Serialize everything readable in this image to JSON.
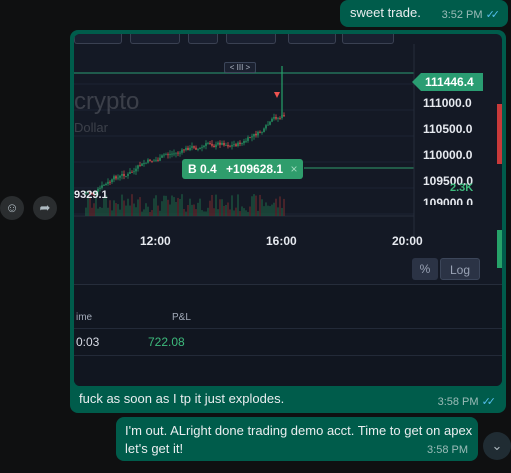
{
  "messages": {
    "m1": {
      "text": "sweet trade.",
      "time": "3:52 PM"
    },
    "m2": {
      "caption": "fuck as soon as I tp it just explodes.",
      "time": "3:58 PM"
    },
    "m3": {
      "line1": "I'm out. ALright done trading demo acct. Time to get on apex",
      "line2": "let's get it!",
      "time": "3:58 PM"
    }
  },
  "chart": {
    "watermark": "crypto",
    "watermark_sub": "Dollar",
    "range_handle": "< III >",
    "current_price": "111446.4",
    "price_ticks": [
      "111000.0",
      "110500.0",
      "110000.0",
      "109500.0",
      "109000.0"
    ],
    "volume_label": "2.3K",
    "position_label": "B 0.4",
    "position_pnl": "+109628.1",
    "position_close": "×",
    "left_price": "9329.1",
    "time_ticks": [
      "12:00",
      "16:00",
      "20:00"
    ],
    "percent_btn": "%",
    "log_btn": "Log"
  },
  "positions_table": {
    "headers": [
      "ime",
      "P&L"
    ],
    "row": {
      "time": "0:03",
      "pnl": "722.08"
    }
  },
  "icons": {
    "double_check": "double-check-icon",
    "emoji": "emoji-icon",
    "forward": "forward-icon",
    "scroll_down": "chevron-down-icon"
  },
  "colors": {
    "outgoing_bubble": "#005c4b",
    "read_ticks": "#53bdeb",
    "chart_bg": "#141925",
    "up_candle": "#26a269",
    "down_candle": "#ef5350",
    "pnl_green": "#3dba7c"
  }
}
